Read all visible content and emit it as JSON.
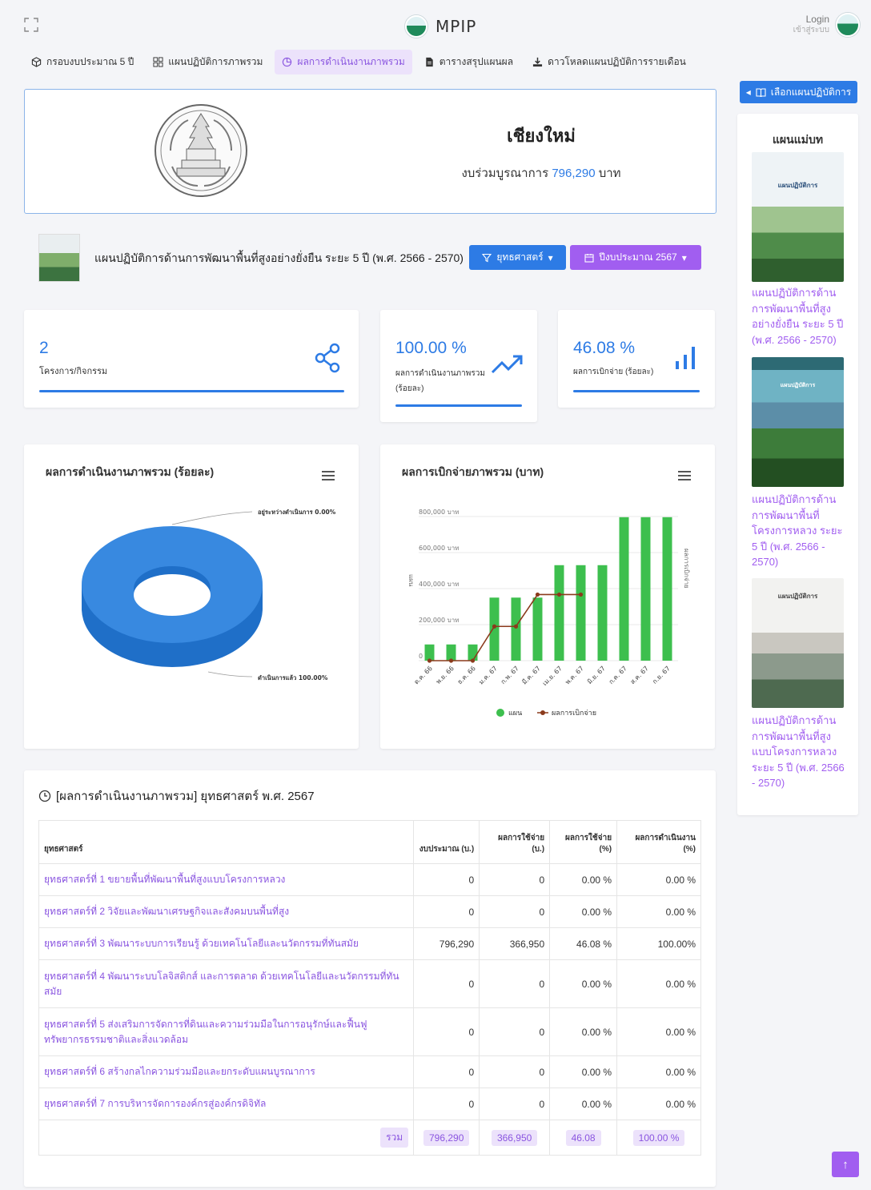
{
  "header": {
    "brand": "MPIP",
    "login": "Login",
    "login_sub": "เข้าสู่ระบบ"
  },
  "nav": [
    {
      "label": "กรอบงบประมาณ 5 ปี",
      "icon": "cube-icon"
    },
    {
      "label": "แผนปฏิบัติการภาพรวม",
      "icon": "grid-icon"
    },
    {
      "label": "ผลการดำเนินงานภาพรวม",
      "icon": "pie-icon",
      "active": true
    },
    {
      "label": "ตารางสรุปแผนผล",
      "icon": "file-icon"
    },
    {
      "label": "ดาวโหลดแผนปฏิบัติการรายเดือน",
      "icon": "download-icon"
    }
  ],
  "hero": {
    "title": "เชียงใหม่",
    "budget_prefix": "งบร่วมบูรณาการ ",
    "budget_value": "796,290",
    "budget_suffix": " บาท"
  },
  "plan": {
    "title": "แผนปฏิบัติการด้านการพัฒนาพื้นที่สูงอย่างยั่งยืน ระยะ 5 ปี (พ.ศ. 2566 - 2570)",
    "strategy_button": "ยุทธศาสตร์",
    "year_button": "ปีงบประมาณ 2567"
  },
  "stats": [
    {
      "value": "2",
      "label": "โครงการ/กิจกรรม"
    },
    {
      "value": "100.00 %",
      "label_1": "ผลการดำเนินงานภาพรวม",
      "label_2": "(ร้อยละ)"
    },
    {
      "value": "46.08 %",
      "label": "ผลการเบิกจ่าย (ร้อยละ)"
    }
  ],
  "donut": {
    "title": "ผลการดำเนินงานภาพรวม (ร้อยละ)",
    "label_pending": "อยู่ระหว่างดำเนินการ 0.00%",
    "label_done": "ดำเนินการแล้ว 100.00%"
  },
  "combo": {
    "title": "ผลการเบิกจ่ายภาพรวม (บาท)",
    "y_left": "แผน",
    "y_right": "ผลการเบิกจ่าย",
    "legend_plan": "แผน",
    "legend_actual": "ผลการเบิกจ่าย"
  },
  "chart_data": [
    {
      "type": "pie",
      "title": "ผลการดำเนินงานภาพรวม (ร้อยละ)",
      "categories": [
        "อยู่ระหว่างดำเนินการ",
        "ดำเนินการแล้ว"
      ],
      "values": [
        0.0,
        100.0
      ]
    },
    {
      "type": "bar",
      "title": "ผลการเบิกจ่ายภาพรวม (บาท)",
      "categories": [
        "ต.ค. 66",
        "พ.ย. 66",
        "ธ.ค. 66",
        "ม.ค. 67",
        "ก.พ. 67",
        "มี.ค. 67",
        "เม.ย. 67",
        "พ.ค. 67",
        "มิ.ย. 67",
        "ก.ค. 67",
        "ส.ค. 67",
        "ก.ย. 67"
      ],
      "yticks": [
        "0",
        "200,000 บาท",
        "400,000 บาท",
        "600,000 บาท",
        "800,000 บาท"
      ],
      "ylim": [
        0,
        800000
      ],
      "ylabel": "แผน",
      "y2label": "ผลการเบิกจ่าย",
      "legend": "bottom",
      "series": [
        {
          "name": "แผน",
          "type": "bar",
          "color": "#3dbf4e",
          "values": [
            90000,
            90000,
            90000,
            350000,
            350000,
            350000,
            530000,
            530000,
            530000,
            796290,
            796290,
            796290
          ]
        },
        {
          "name": "ผลการเบิกจ่าย",
          "type": "line",
          "color": "#8b3a1c",
          "values": [
            0,
            0,
            0,
            190000,
            190000,
            366950,
            366950,
            366950,
            null,
            null,
            null,
            null
          ]
        }
      ]
    }
  ],
  "table": {
    "title": "[ผลการดำเนินงานภาพรวม] ยุทธศาสตร์ พ.ศ. 2567",
    "headers": [
      "ยุทธศาสตร์",
      "งบประมาณ (บ.)",
      "ผลการใช้จ่าย (บ.)",
      "ผลการใช้จ่าย (%)",
      "ผลการดำเนินงาน (%)"
    ],
    "rows": [
      {
        "name": "ยุทธศาสตร์ที่ 1 ขยายพื้นที่พัฒนาพื้นที่สูงแบบโครงการหลวง",
        "budget": "0",
        "spent": "0",
        "spent_pct": "0.00 %",
        "perf": "0.00 %"
      },
      {
        "name": "ยุทธศาสตร์ที่ 2 วิจัยและพัฒนาเศรษฐกิจและสังคมบนพื้นที่สูง",
        "budget": "0",
        "spent": "0",
        "spent_pct": "0.00 %",
        "perf": "0.00 %"
      },
      {
        "name": "ยุทธศาสตร์ที่ 3 พัฒนาระบบการเรียนรู้ ด้วยเทคโนโลยีและนวัตกรรมที่ทันสมัย",
        "budget": "796,290",
        "spent": "366,950",
        "spent_pct": "46.08 %",
        "perf": "100.00%"
      },
      {
        "name": "ยุทธศาสตร์ที่ 4 พัฒนาระบบโลจิสติกส์ และการตลาด ด้วยเทคโนโลยีและนวัตกรรมที่ทันสมัย",
        "budget": "0",
        "spent": "0",
        "spent_pct": "0.00 %",
        "perf": "0.00 %"
      },
      {
        "name": "ยุทธศาสตร์ที่ 5 ส่งเสริมการจัดการที่ดินและความร่วมมือในการอนุรักษ์และฟื้นฟูทรัพยากรธรรมชาติและสิ่งแวดล้อม",
        "budget": "0",
        "spent": "0",
        "spent_pct": "0.00 %",
        "perf": "0.00 %"
      },
      {
        "name": "ยุทธศาสตร์ที่ 6 สร้างกลไกความร่วมมือและยกระดับแผนบูรณาการ",
        "budget": "0",
        "spent": "0",
        "spent_pct": "0.00 %",
        "perf": "0.00 %"
      },
      {
        "name": "ยุทธศาสตร์ที่ 7 การบริหารจัดการองค์กรสู่องค์กรดิจิทัล",
        "budget": "0",
        "spent": "0",
        "spent_pct": "0.00 %",
        "perf": "0.00 %"
      }
    ],
    "total": {
      "label": "รวม",
      "budget": "796,290",
      "spent": "366,950",
      "spent_pct": "46.08",
      "perf": "100.00 %"
    }
  },
  "sidebar": {
    "button": "เลือกแผนปฏิบัติการ",
    "title": "แผนแม่บท",
    "items": [
      {
        "label": "แผนปฏิบัติการด้านการพัฒนาพื้นที่สูงอย่างยั่งยืน ระยะ 5 ปี (พ.ศ. 2566 - 2570)",
        "cover_title": "แผนปฏิบัติการ"
      },
      {
        "label": "แผนปฏิบัติการด้านการพัฒนาพื้นที่โครงการหลวง ระยะ 5 ปี (พ.ศ. 2566 - 2570)",
        "cover_title": "แผนปฏิบัติการ"
      },
      {
        "label": "แผนปฏิบัติการด้านการพัฒนาพื้นที่สูงแบบโครงการหลวง ระยะ 5 ปี (พ.ศ. 2566 - 2570)",
        "cover_title": "แผนปฏิบัติการ"
      }
    ]
  }
}
